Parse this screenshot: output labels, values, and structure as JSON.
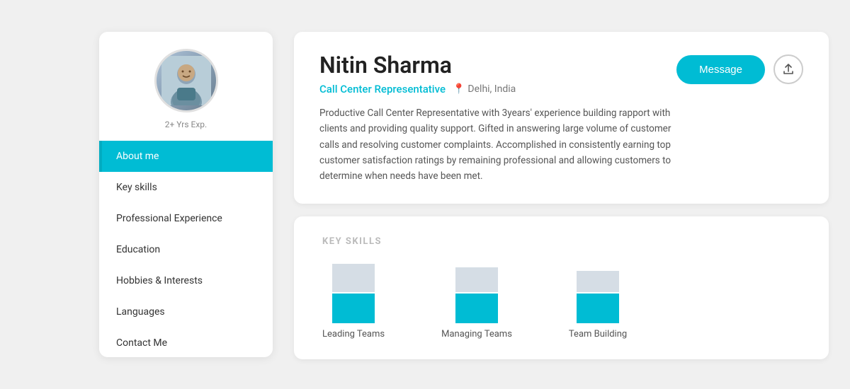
{
  "sidebar": {
    "exp_label": "2+ Yrs Exp.",
    "nav_items": [
      {
        "id": "about-me",
        "label": "About me",
        "active": true
      },
      {
        "id": "key-skills",
        "label": "Key skills",
        "active": false
      },
      {
        "id": "professional-experience",
        "label": "Professional Experience",
        "active": false
      },
      {
        "id": "education",
        "label": "Education",
        "active": false
      },
      {
        "id": "hobbies-interests",
        "label": "Hobbies & Interests",
        "active": false
      },
      {
        "id": "languages",
        "label": "Languages",
        "active": false
      },
      {
        "id": "contact-me",
        "label": "Contact Me",
        "active": false
      }
    ]
  },
  "profile": {
    "name": "Nitin Sharma",
    "title": "Call Center Representative",
    "location": "Delhi, India",
    "bio": "Productive Call Center Representative with 3years' experience building rapport with clients and providing quality support. Gifted in answering large volume of customer calls and resolving customer complaints. Accomplished in consistently earning top customer satisfaction ratings by remaining professional and allowing customers to determine when needs have been met.",
    "message_btn": "Message"
  },
  "skills": {
    "section_title": "KEY SKILLS",
    "items": [
      {
        "label": "Leading Teams",
        "bar_top_height": 40,
        "bar_bottom_height": 42
      },
      {
        "label": "Managing Teams",
        "bar_top_height": 35,
        "bar_bottom_height": 42
      },
      {
        "label": "Team Building",
        "bar_top_height": 30,
        "bar_bottom_height": 42
      }
    ]
  },
  "icons": {
    "location": "📍",
    "share": "↑"
  }
}
